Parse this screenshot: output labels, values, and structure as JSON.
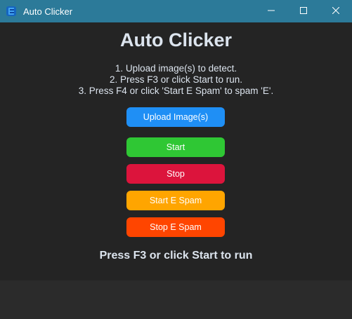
{
  "window": {
    "title": "Auto Clicker",
    "icon": "app-icon",
    "controls": [
      "minimize-icon",
      "maximize-icon",
      "close-icon"
    ],
    "titlebar_color": "#2c7a99"
  },
  "app": {
    "heading": "Auto Clicker",
    "instructions": [
      "1. Upload image(s) to detect.",
      "2. Press F3 or click Start to run.",
      "3. Press F4 or click 'Start E Spam' to spam 'E'."
    ]
  },
  "buttons": {
    "upload": {
      "label": "Upload Image(s)",
      "color": "#1f8ff5"
    },
    "start": {
      "label": "Start",
      "color": "#2fc734"
    },
    "stop": {
      "label": "Stop",
      "color": "#dc143c"
    },
    "start_e_spam": {
      "label": "Start E Spam",
      "color": "#ffa500"
    },
    "stop_e_spam": {
      "label": "Stop E Spam",
      "color": "#ff4500"
    }
  },
  "status": {
    "text": "Press F3 or click Start to run"
  }
}
